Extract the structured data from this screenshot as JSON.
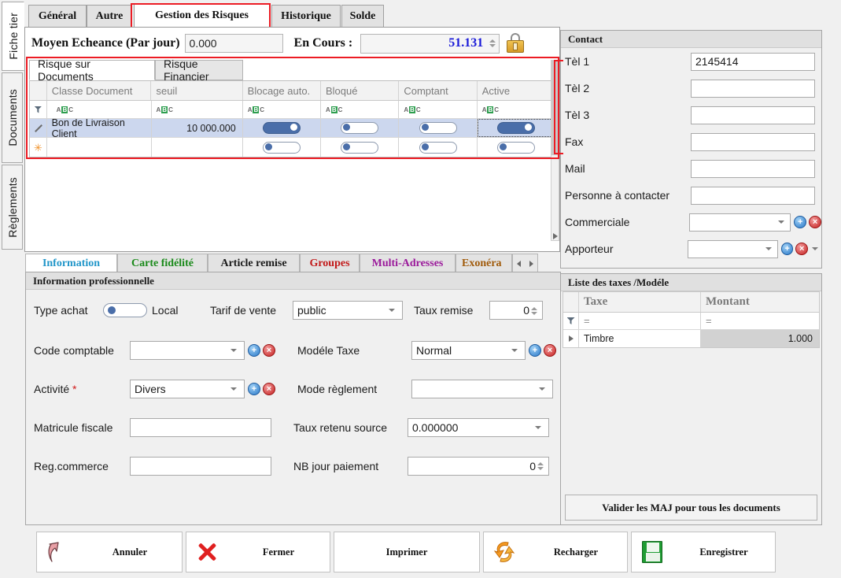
{
  "window": {
    "truncated_top_text": ""
  },
  "left_tabs": [
    {
      "label": "Fiche tier",
      "active": true
    },
    {
      "label": "Documents",
      "active": false
    },
    {
      "label": "Règlements",
      "active": false
    }
  ],
  "top_tabs": [
    {
      "label": "Général",
      "active": false
    },
    {
      "label": "Autre",
      "active": false
    },
    {
      "label": "Gestion des Risques",
      "active": true,
      "highlighted": true
    },
    {
      "label": "Historique",
      "active": false
    },
    {
      "label": "Solde",
      "active": false
    }
  ],
  "risk_header": {
    "moyen_label": "Moyen Echeance (Par jour)",
    "moyen_value": "0.000",
    "encours_label": "En Cours :",
    "encours_value": "51.131",
    "lock_icon": "lock-icon"
  },
  "sub_tabs": [
    {
      "label": "Risque sur Documents",
      "active": true
    },
    {
      "label": "Risque Financier",
      "active": false
    }
  ],
  "risk_grid": {
    "columns": [
      "Classe Document",
      "seuil",
      "Blocage auto.",
      "Bloqué",
      "Comptant",
      "Active"
    ],
    "filter_glyphs": [
      "ABC",
      "ABC",
      "ABC",
      "ABC",
      "ABC"
    ],
    "rows": [
      {
        "indicator": "edit-pencil-icon",
        "classe_document": "Bon de Livraison Client",
        "seuil": "10 000.000",
        "blocage_auto": true,
        "bloque": false,
        "comptant": false,
        "active": true,
        "selected": true
      },
      {
        "indicator": "new-row-icon",
        "classe_document": "",
        "seuil": "",
        "blocage_auto": false,
        "bloque": false,
        "comptant": false,
        "active": false,
        "selected": false
      }
    ]
  },
  "contact": {
    "title": "Contact",
    "fields": [
      {
        "label": "Tèl 1",
        "value": "2145414",
        "type": "text"
      },
      {
        "label": "Tèl 2",
        "value": "",
        "type": "text"
      },
      {
        "label": "Tèl 3",
        "value": "",
        "type": "text"
      },
      {
        "label": "Fax",
        "value": "",
        "type": "text"
      },
      {
        "label": "Mail",
        "value": "",
        "type": "text"
      },
      {
        "label": "Personne à contacter",
        "value": "",
        "type": "text"
      },
      {
        "label": "Commerciale",
        "value": "",
        "type": "combo-add-del"
      },
      {
        "label": "Apporteur",
        "value": "",
        "type": "combo-add-del-drop"
      }
    ]
  },
  "bottom_tabs": [
    {
      "label": "Information",
      "color": "#2196c9",
      "active": true
    },
    {
      "label": "Carte fidélité",
      "color": "#1a8a1a",
      "active": false
    },
    {
      "label": "Article remise",
      "color": "#1a1a1a",
      "active": false
    },
    {
      "label": "Groupes",
      "color": "#c21a1a",
      "active": false
    },
    {
      "label": "Multi-Adresses",
      "color": "#9b1a9b",
      "active": false
    },
    {
      "label": "Exonéra",
      "color": "#a05a0a",
      "active": false
    }
  ],
  "info_panel": {
    "title": "Information professionnelle",
    "rows": [
      {
        "left": {
          "label": "Type achat",
          "type": "toggle",
          "value": false,
          "suffix": "Local"
        },
        "mid": {
          "label": "Tarif de vente",
          "type": "combo",
          "value": "public"
        },
        "right": {
          "label": "Taux remise",
          "type": "spinner",
          "value": "0"
        }
      },
      {
        "left": {
          "label": "Code comptable",
          "type": "combo-add-del",
          "value": ""
        },
        "right": {
          "label": "Modéle Taxe",
          "type": "combo-add-del",
          "value": "Normal"
        }
      },
      {
        "left": {
          "label": "Activité",
          "required": true,
          "type": "combo-add-del",
          "value": "Divers"
        },
        "right": {
          "label": "Mode règlement",
          "type": "combo",
          "value": ""
        }
      },
      {
        "left": {
          "label": "Matricule fiscale",
          "type": "text",
          "value": ""
        },
        "right": {
          "label": "Taux retenu source",
          "type": "combo",
          "value": "0.000000"
        }
      },
      {
        "left": {
          "label": "Reg.commerce",
          "type": "text",
          "value": ""
        },
        "right": {
          "label": "NB jour paiement",
          "type": "spinner",
          "value": "0"
        }
      }
    ]
  },
  "taxes_panel": {
    "title": "Liste des taxes /Modéle",
    "columns": [
      "Taxe",
      "Montant"
    ],
    "filter_ops": [
      "=",
      "="
    ],
    "rows": [
      {
        "indicator": "expand-arrow-icon",
        "taxe": "Timbre",
        "montant": "1.000"
      }
    ],
    "validate_button": "Valider les MAJ pour tous les documents"
  },
  "action_buttons": [
    {
      "label": "Annuler",
      "icon": "undo-arrow-icon"
    },
    {
      "label": "Fermer",
      "icon": "red-x-icon"
    },
    {
      "label": "Imprimer",
      "icon": "none"
    },
    {
      "label": "Recharger",
      "icon": "refresh-icon"
    },
    {
      "label": "Enregistrer",
      "icon": "save-floppy-icon"
    }
  ],
  "colors": {
    "highlight_red": "#ec1c24",
    "encours_blue": "#1a1ad8",
    "row_selected": "#ccd7ee",
    "toggle_on": "#4a6ea9"
  }
}
